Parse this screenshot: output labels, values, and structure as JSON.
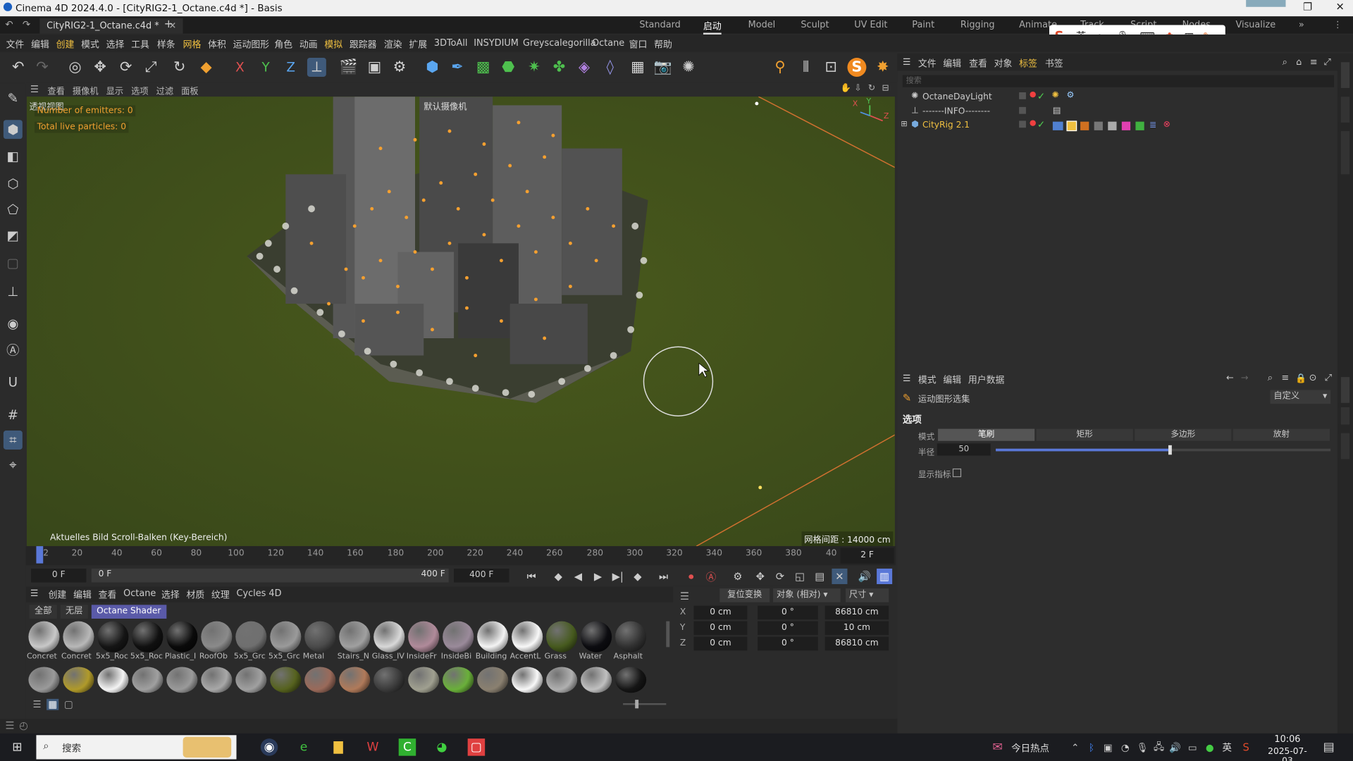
{
  "window": {
    "title": "Cinema 4D 2024.4.0 - [CityRIG2-1_Octane.c4d *] - Basis"
  },
  "doc_tab": {
    "label": "CityRIG2-1_Octane.c4d *"
  },
  "layouts": [
    "Standard",
    "启动",
    "Model",
    "Sculpt",
    "UV Edit",
    "Paint",
    "Rigging",
    "Animate",
    "Track",
    "Script",
    "Nodes",
    "Visualize"
  ],
  "menubar": [
    "文件",
    "编辑",
    "创建",
    "模式",
    "选择",
    "工具",
    "样条",
    "网格",
    "体积",
    "运动图形",
    "角色",
    "动画",
    "模拟",
    "跟踪器",
    "渲染",
    "扩展",
    "3DToAll",
    "INSYDIUM",
    "Greyscalegorilla",
    "Octane",
    "窗口",
    "帮助"
  ],
  "viewport_menu": [
    "查看",
    "摄像机",
    "显示",
    "选项",
    "过滤",
    "面板"
  ],
  "viewport": {
    "view_name": "透视视图",
    "camera": "默认摄像机",
    "hud_emitters": "Number of emitters: 0",
    "hud_particles": "Total live particles: 0",
    "status_text": "Aktuelles Bild Scroll-Balken (Key-Bereich)",
    "grid_spacing": "网格间距 : 14000 cm",
    "axis_x": "X",
    "axis_y": "Y",
    "axis_z": "Z"
  },
  "timeline": {
    "ticks": [
      "2",
      "20",
      "40",
      "60",
      "80",
      "100",
      "120",
      "140",
      "160",
      "180",
      "200",
      "220",
      "240",
      "260",
      "280",
      "300",
      "320",
      "340",
      "360",
      "380",
      "40"
    ],
    "current_frame": "2 F",
    "start_field": "0 F",
    "min_field": "0 F",
    "max_field": "400 F",
    "end_field": "400 F"
  },
  "material_manager": {
    "menu": [
      "创建",
      "编辑",
      "查看",
      "Octane",
      "选择",
      "材质",
      "纹理",
      "Cycles 4D"
    ],
    "filters": [
      "全部",
      "无层",
      "Octane Shader"
    ],
    "row1": [
      {
        "label": "Concret",
        "color": "#c8c8c8"
      },
      {
        "label": "Concret",
        "color": "#b8b8b8"
      },
      {
        "label": "5x5_Roc",
        "color": "#151515"
      },
      {
        "label": "5x5_Roc",
        "color": "#101010"
      },
      {
        "label": "Plastic_I",
        "color": "#0a0a0a"
      },
      {
        "label": "RoofOb",
        "color": "#8a8a8a"
      },
      {
        "label": "5x5_Grc",
        "color": "#6f6f6f"
      },
      {
        "label": "5x5_Grc",
        "color": "#9a9a9a"
      },
      {
        "label": "Metal",
        "color": "#4a4a4a"
      },
      {
        "label": "Stairs_N",
        "color": "#a0a0a0"
      },
      {
        "label": "Glass_IV",
        "color": "#d8d8d8"
      },
      {
        "label": "InsideFr",
        "color": "#b08a9a"
      },
      {
        "label": "InsideBi",
        "color": "#9a8a9a"
      },
      {
        "label": "Building",
        "color": "#f4f4f4"
      },
      {
        "label": "AccentL",
        "color": "#f8f8f8"
      },
      {
        "label": "Grass",
        "color": "#465a1e"
      },
      {
        "label": "Water",
        "color": "#0c0c10"
      },
      {
        "label": "Asphalt",
        "color": "#303030"
      }
    ],
    "row2_colors": [
      "#9a9a9a",
      "#b09a2a",
      "#f4f4f4",
      "#a0a0a0",
      "#9a9a9a",
      "#a8a8a8",
      "#a0a0a0",
      "#56621e",
      "#9a6a5a",
      "#b07a5a",
      "#3a3a3a",
      "#a0a090",
      "#6ab03a",
      "#8a8070",
      "#f8f8f8",
      "#b0b0b0",
      "#c0c0c0",
      "#151515"
    ]
  },
  "coords": {
    "reset_label": "复位变换",
    "mode_label": "对象 (相对)",
    "size_label": "尺寸",
    "rows": [
      {
        "axis": "X",
        "pos": "0 cm",
        "rot": "0 °",
        "size": "86810 cm"
      },
      {
        "axis": "Y",
        "pos": "0 cm",
        "rot": "0 °",
        "size": "10 cm"
      },
      {
        "axis": "Z",
        "pos": "0 cm",
        "rot": "0 °",
        "size": "86810 cm"
      }
    ]
  },
  "object_manager": {
    "menu": [
      "文件",
      "编辑",
      "查看",
      "对象",
      "标签",
      "书签"
    ],
    "search_placeholder": "搜索",
    "objects": [
      "OctaneDayLight",
      "-------INFO--------",
      "CityRig 2.1"
    ]
  },
  "attribute_manager": {
    "menu": [
      "模式",
      "编辑",
      "用户数据"
    ],
    "tool_name": "运动图形选集",
    "preset": "自定义",
    "section": "选项",
    "mode_label": "模式",
    "modes": [
      "笔刷",
      "矩形",
      "多边形",
      "放射"
    ],
    "radius_label": "半径",
    "radius_value": "50",
    "radius_fraction": 0.52,
    "show_indicator_label": "显示指标"
  },
  "taskbar": {
    "search_label": "搜索",
    "news": "今日热点",
    "ime_lang": "英",
    "time": "10:06",
    "date": "2025-07-03"
  },
  "colors": {
    "accent": "#5aa6f0",
    "timeline_marker": "#5a78d8",
    "viewport_ground": "#3d4e15",
    "highlight_tag": "#f0c040"
  }
}
